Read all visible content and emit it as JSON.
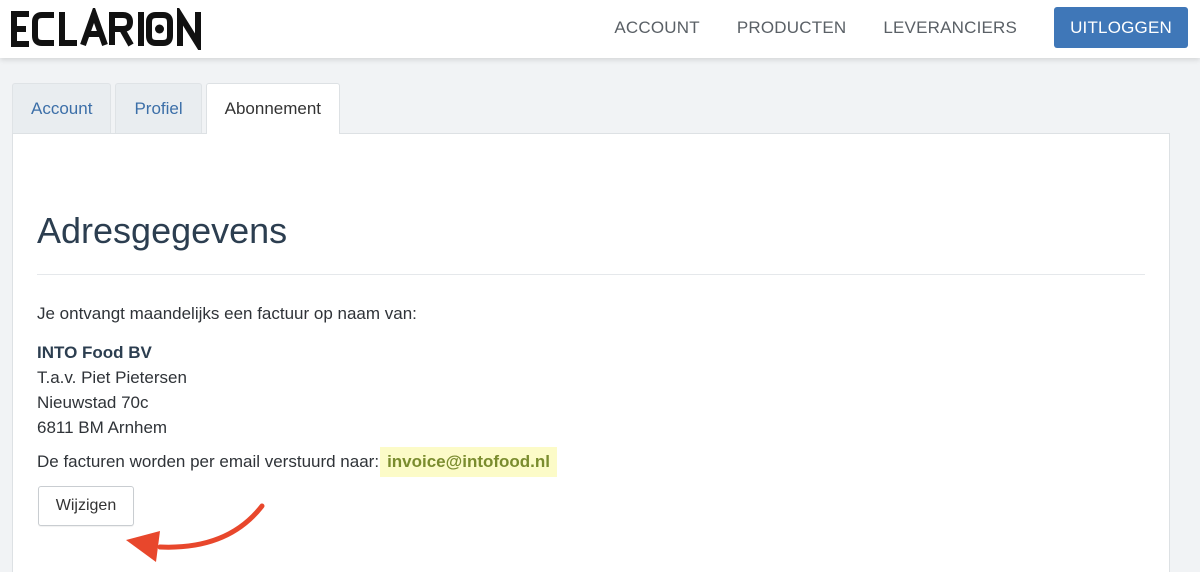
{
  "brand": {
    "logo_text": "ECLARION"
  },
  "navbar": {
    "links": [
      {
        "label": "ACCOUNT"
      },
      {
        "label": "PRODUCTEN"
      },
      {
        "label": "LEVERANCIERS"
      }
    ],
    "logout_label": "UITLOGGEN"
  },
  "tabs": [
    {
      "label": "Account",
      "active": false
    },
    {
      "label": "Profiel",
      "active": false
    },
    {
      "label": "Abonnement",
      "active": true
    }
  ],
  "section": {
    "heading": "Adresgegevens",
    "intro": "Je ontvangt maandelijks een factuur op naam van:",
    "address": {
      "company": "INTO Food BV",
      "attention": "T.a.v. Piet Pietersen",
      "street": "Nieuwstad 70c",
      "city": "6811 BM Arnhem"
    },
    "email_prefix": "De facturen worden per email verstuurd naar:",
    "email": "invoice@intofood.nl",
    "edit_button": "Wijzigen"
  },
  "colors": {
    "accent": "#3f77b8",
    "annotation_arrow": "#e8472c",
    "highlight": "#fcfbc8"
  }
}
